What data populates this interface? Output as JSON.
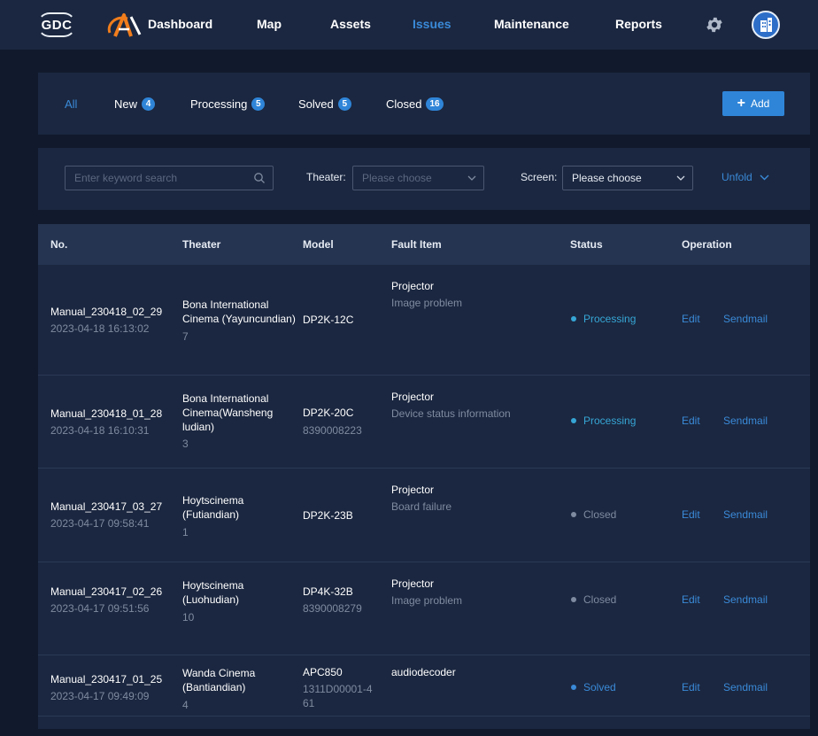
{
  "nav": {
    "logo_text": "GDC",
    "items": [
      {
        "label": "Dashboard"
      },
      {
        "label": "Map"
      },
      {
        "label": "Assets"
      },
      {
        "label": "Issues"
      },
      {
        "label": "Maintenance"
      },
      {
        "label": "Reports"
      }
    ],
    "active": "Issues",
    "settings_icon": "gear-icon",
    "avatar_icon": "building-icon"
  },
  "tabs": {
    "items": [
      {
        "label": "All",
        "count": null
      },
      {
        "label": "New",
        "count": "4"
      },
      {
        "label": "Processing",
        "count": "5"
      },
      {
        "label": "Solved",
        "count": "5"
      },
      {
        "label": "Closed",
        "count": "16"
      }
    ],
    "active": "All",
    "add_label": "Add"
  },
  "filters": {
    "keyword_placeholder": "Enter keyword search",
    "theater_label": "Theater:",
    "theater_placeholder": "Please choose",
    "screen_label": "Screen:",
    "screen_value": "Please choose",
    "unfold_label": "Unfold"
  },
  "table": {
    "headers": [
      "No.",
      "Theater",
      "Model",
      "Fault Item",
      "Status",
      "Operation"
    ],
    "rows": [
      {
        "no": "Manual_230418_02_29",
        "time": "2023-04-18 16:13:02",
        "theater": [
          "Bona International",
          "Cinema (Yayuncundian)"
        ],
        "screen": "7",
        "model": "DP2K-12C",
        "serial": "",
        "fault_category": "Projector",
        "fault_detail": "Image problem",
        "status": "Processing",
        "edit": "Edit",
        "sendmail": "Sendmail"
      },
      {
        "no": "Manual_230418_01_28",
        "time": "2023-04-18 16:10:31",
        "theater": [
          "Bona International",
          "Cinema(Wansheng",
          "ludian)"
        ],
        "screen": "3",
        "model": "DP2K-20C",
        "serial": "8390008223",
        "fault_category": "Projector",
        "fault_detail": "Device status information",
        "status": "Processing",
        "edit": "Edit",
        "sendmail": "Sendmail"
      },
      {
        "no": "Manual_230417_03_27",
        "time": "2023-04-17 09:58:41",
        "theater": [
          "Hoytscinema",
          "(Futiandian)"
        ],
        "screen": "1",
        "model": "DP2K-23B",
        "serial": "",
        "fault_category": "Projector",
        "fault_detail": "Board failure",
        "status": "Closed",
        "edit": "Edit",
        "sendmail": "Sendmail"
      },
      {
        "no": "Manual_230417_02_26",
        "time": "2023-04-17 09:51:56",
        "theater": [
          "Hoytscinema",
          "(Luohudian)"
        ],
        "screen": "10",
        "model": "DP4K-32B",
        "serial": "8390008279",
        "fault_category": "Projector",
        "fault_detail": "Image problem",
        "status": "Closed",
        "edit": "Edit",
        "sendmail": "Sendmail"
      },
      {
        "no": "Manual_230417_01_25",
        "time": "2023-04-17 09:49:09",
        "theater": [
          "Wanda Cinema",
          "(Bantiandian)"
        ],
        "screen": "4",
        "model": "APC850",
        "serial": "1311D00001-461",
        "fault_category": "audiodecoder",
        "fault_detail": "",
        "status": "Solved",
        "edit": "Edit",
        "sendmail": "Sendmail"
      }
    ]
  },
  "colors": {
    "accent": "#3a8ad8",
    "status_processing": "#36a6d6",
    "status_closed": "#7f8ba0",
    "status_solved": "#3a8ad8"
  }
}
